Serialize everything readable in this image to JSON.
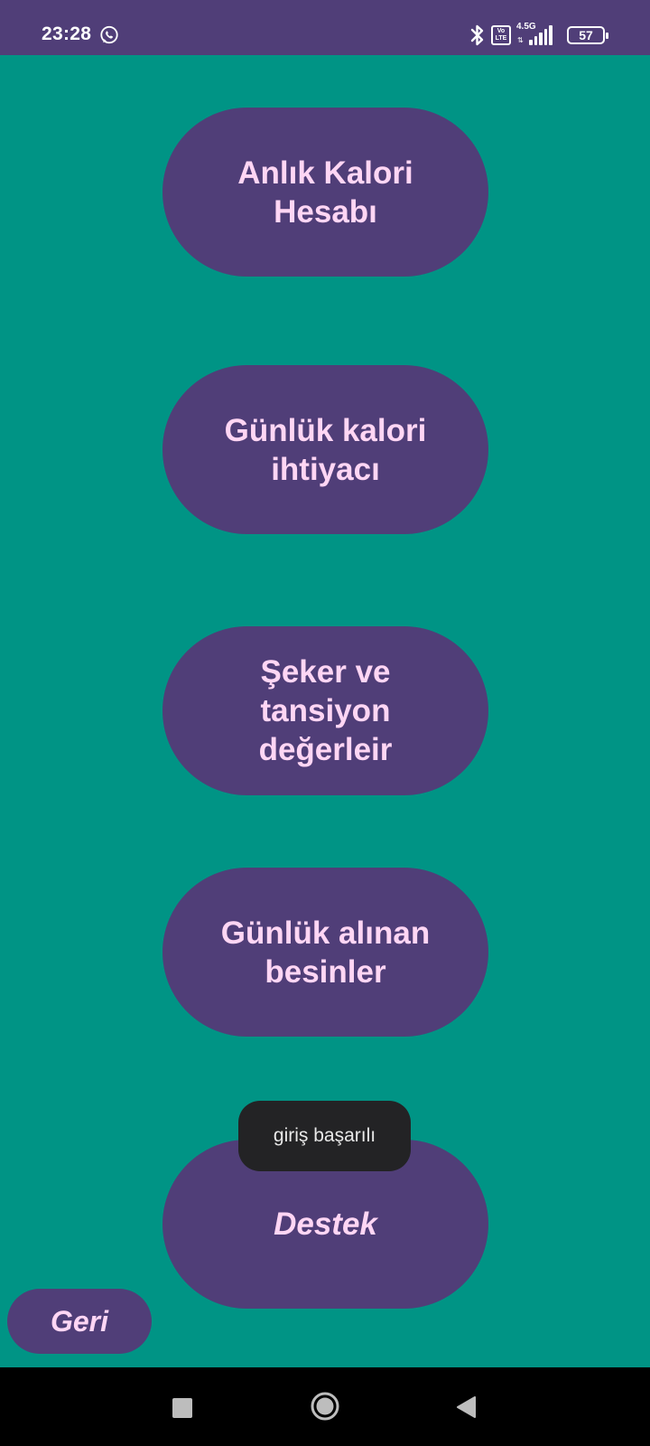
{
  "status_bar": {
    "time": "23:28",
    "network": "4.5G",
    "volte": "Vo\nLTE",
    "battery": "57",
    "icons": [
      "whatsapp-icon",
      "bluetooth-icon",
      "volte-icon",
      "signal-icon",
      "battery-icon"
    ]
  },
  "menu": {
    "instant_calorie": "Anlık Kalori Hesabı",
    "daily_calorie_need": "Günlük kalori ihtiyacı",
    "sugar_pressure": "Şeker ve tansiyon değerleir",
    "daily_food": "Günlük alınan besinler",
    "support": "Destek"
  },
  "back_button": "Geri",
  "toast": "giriş başarılı",
  "nav_bar": {
    "icons": [
      "recents-square-icon",
      "home-circle-icon",
      "back-triangle-icon"
    ]
  },
  "colors": {
    "background": "#009485",
    "button": "#503e78",
    "button_text": "#ffd6f4",
    "status_bar": "#503e78",
    "toast": "#232325"
  }
}
